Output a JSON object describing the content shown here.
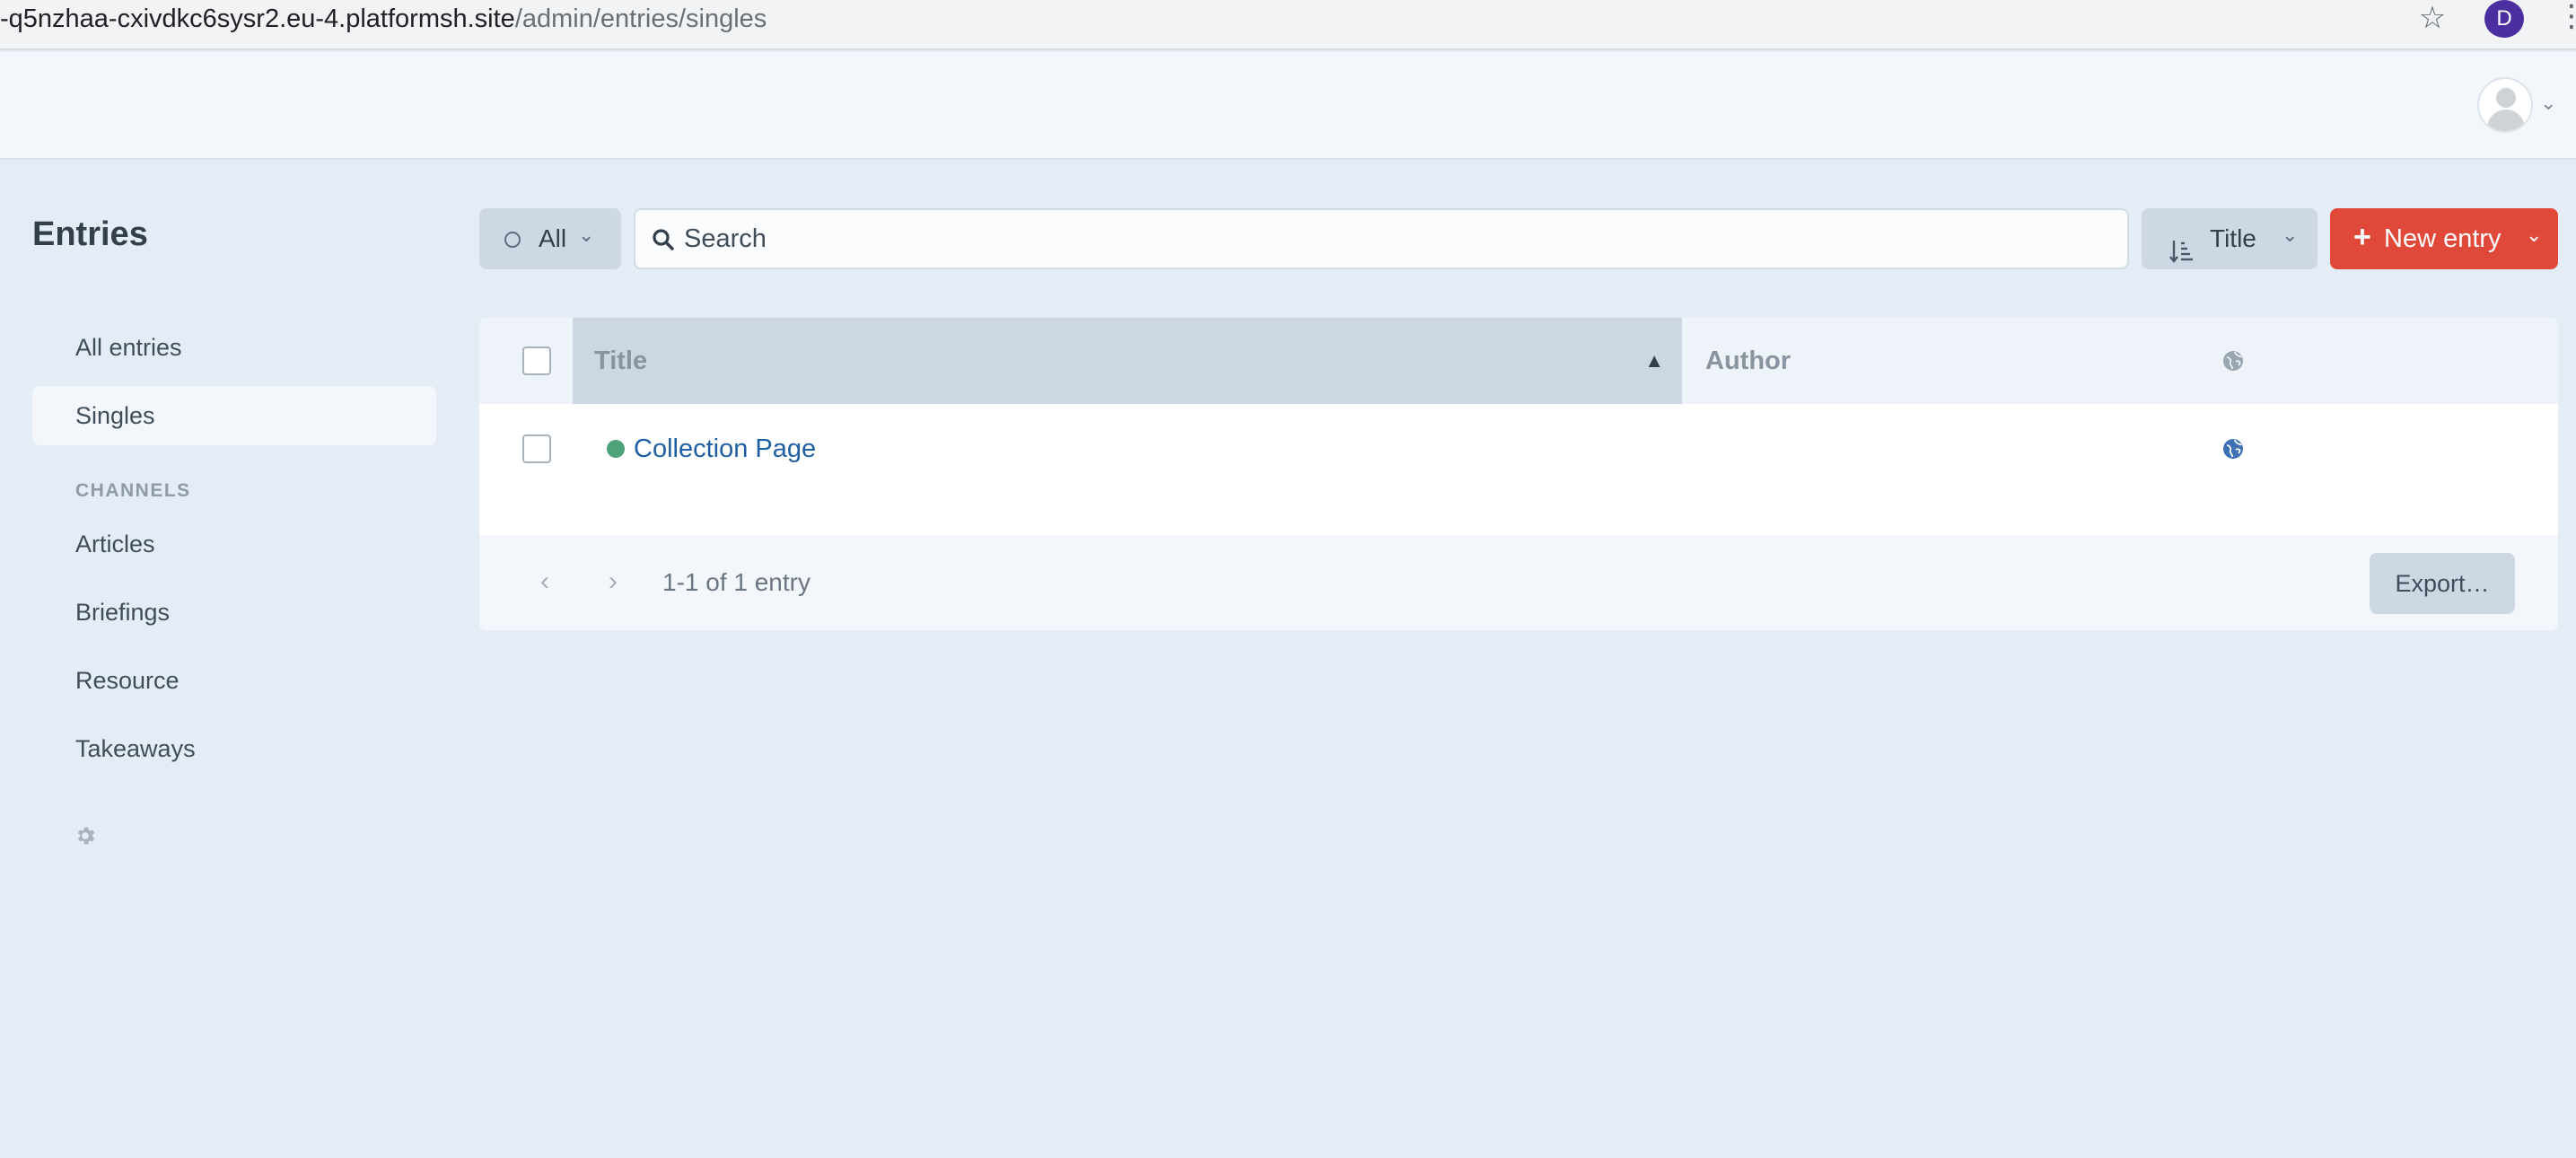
{
  "browser": {
    "url_host": "-q5nzhaa-cxivdkc6sysr2.eu-4.platformsh.site",
    "url_path": "/admin/entries/singles",
    "profile_initial": "D"
  },
  "sidebar": {
    "title": "Entries",
    "items": [
      {
        "label": "All entries"
      },
      {
        "label": "Singles",
        "active": true
      }
    ],
    "channels_heading": "CHANNELS",
    "channels": [
      {
        "label": "Articles"
      },
      {
        "label": "Briefings"
      },
      {
        "label": "Resource"
      },
      {
        "label": "Takeaways"
      }
    ]
  },
  "toolbar": {
    "status_label": "All",
    "search_placeholder": "Search",
    "sort_label": "Title",
    "new_entry_label": "New entry"
  },
  "table": {
    "columns": {
      "title": "Title",
      "author": "Author"
    },
    "rows": [
      {
        "title": "Collection Page",
        "author": "",
        "status": "enabled",
        "status_color": "#4fa37a"
      }
    ],
    "pagination": "1-1 of 1 entry",
    "export_label": "Export…"
  },
  "colors": {
    "accent": "#e0493a",
    "link": "#1f5fa3",
    "status_live": "#4fa37a"
  }
}
